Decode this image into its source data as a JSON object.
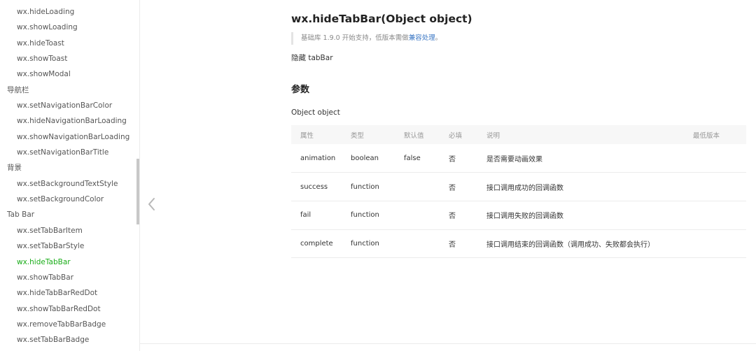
{
  "sidebar": {
    "items": [
      {
        "label": "wx.hideLoading",
        "type": "sub"
      },
      {
        "label": "wx.showLoading",
        "type": "sub"
      },
      {
        "label": "wx.hideToast",
        "type": "sub"
      },
      {
        "label": "wx.showToast",
        "type": "sub"
      },
      {
        "label": "wx.showModal",
        "type": "sub"
      },
      {
        "label": "导航栏",
        "type": "group"
      },
      {
        "label": "wx.setNavigationBarColor",
        "type": "sub"
      },
      {
        "label": "wx.hideNavigationBarLoading",
        "type": "sub"
      },
      {
        "label": "wx.showNavigationBarLoading",
        "type": "sub"
      },
      {
        "label": "wx.setNavigationBarTitle",
        "type": "sub"
      },
      {
        "label": "背景",
        "type": "group"
      },
      {
        "label": "wx.setBackgroundTextStyle",
        "type": "sub"
      },
      {
        "label": "wx.setBackgroundColor",
        "type": "sub"
      },
      {
        "label": "Tab Bar",
        "type": "group"
      },
      {
        "label": "wx.setTabBarItem",
        "type": "sub"
      },
      {
        "label": "wx.setTabBarStyle",
        "type": "sub"
      },
      {
        "label": "wx.hideTabBar",
        "type": "sub",
        "active": true
      },
      {
        "label": "wx.showTabBar",
        "type": "sub"
      },
      {
        "label": "wx.hideTabBarRedDot",
        "type": "sub"
      },
      {
        "label": "wx.showTabBarRedDot",
        "type": "sub"
      },
      {
        "label": "wx.removeTabBarBadge",
        "type": "sub"
      },
      {
        "label": "wx.setTabBarBadge",
        "type": "sub"
      }
    ]
  },
  "main": {
    "title": "wx.hideTabBar(Object object)",
    "note_text": "基础库 1.9.0 开始支持，低版本需做",
    "note_link": "兼容处理",
    "note_end": "。",
    "description": "隐藏 tabBar",
    "section_title": "参数",
    "param_name": "Object object",
    "table": {
      "headers": [
        "属性",
        "类型",
        "默认值",
        "必填",
        "说明",
        "最低版本"
      ],
      "rows": [
        [
          "animation",
          "boolean",
          "false",
          "否",
          "是否需要动画效果",
          ""
        ],
        [
          "success",
          "function",
          "",
          "否",
          "接口调用成功的回调函数",
          ""
        ],
        [
          "fail",
          "function",
          "",
          "否",
          "接口调用失败的回调函数",
          ""
        ],
        [
          "complete",
          "function",
          "",
          "否",
          "接口调用结束的回调函数（调用成功、失败都会执行）",
          ""
        ]
      ]
    }
  },
  "icons": {
    "prev": "chevron-left-icon"
  },
  "colors": {
    "active": "#1aad19",
    "link": "#3b77c4",
    "table_header_bg": "#f7f7f7"
  }
}
